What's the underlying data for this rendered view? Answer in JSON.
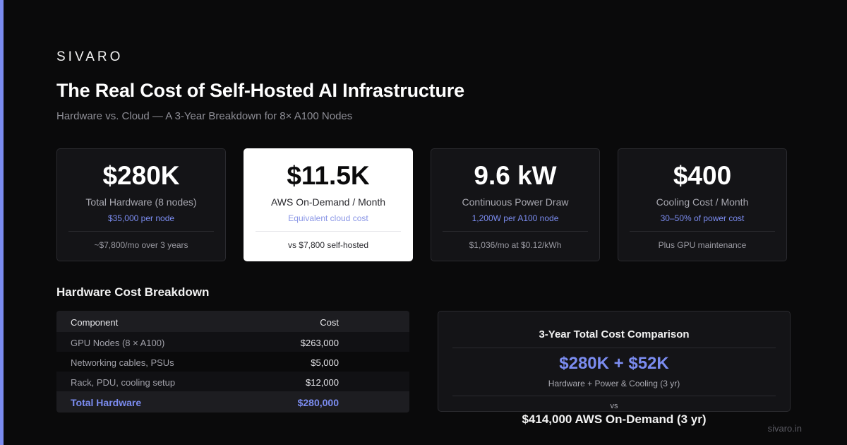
{
  "brand": "SIVARO",
  "title": "The Real Cost of Self-Hosted AI Infrastructure",
  "subtitle": "Hardware vs. Cloud — A 3-Year Breakdown for 8× A100 Nodes",
  "cards": [
    {
      "value": "$280K",
      "label": "Total Hardware (8 nodes)",
      "sub": "$35,000 per node",
      "foot": "~$7,800/mo over 3 years"
    },
    {
      "value": "$11.5K",
      "label": "AWS On-Demand / Month",
      "sub": "Equivalent cloud cost",
      "foot": "vs $7,800 self-hosted"
    },
    {
      "value": "9.6 kW",
      "label": "Continuous Power Draw",
      "sub": "1,200W per A100 node",
      "foot": "$1,036/mo at $0.12/kWh"
    },
    {
      "value": "$400",
      "label": "Cooling Cost / Month",
      "sub": "30–50% of power cost",
      "foot": "Plus GPU maintenance"
    }
  ],
  "breakdown": {
    "title": "Hardware Cost Breakdown",
    "headers": [
      "Component",
      "Cost"
    ],
    "rows": [
      [
        "GPU Nodes (8 × A100)",
        "$263,000"
      ],
      [
        "Networking cables, PSUs",
        "$5,000"
      ],
      [
        "Rack, PDU, cooling setup",
        "$12,000"
      ]
    ],
    "total": [
      "Total Hardware",
      "$280,000"
    ]
  },
  "comparison": {
    "title": "3-Year Total Cost Comparison",
    "value": "$280K + $52K",
    "label": "Hardware + Power & Cooling (3 yr)",
    "vs": "vs",
    "aws": "$414,000 AWS On-Demand (3 yr)"
  },
  "footer": "sivaro.in",
  "colors": {
    "accent": "#7b8cf0",
    "background": "#0a0a0b",
    "card": "#141417"
  }
}
